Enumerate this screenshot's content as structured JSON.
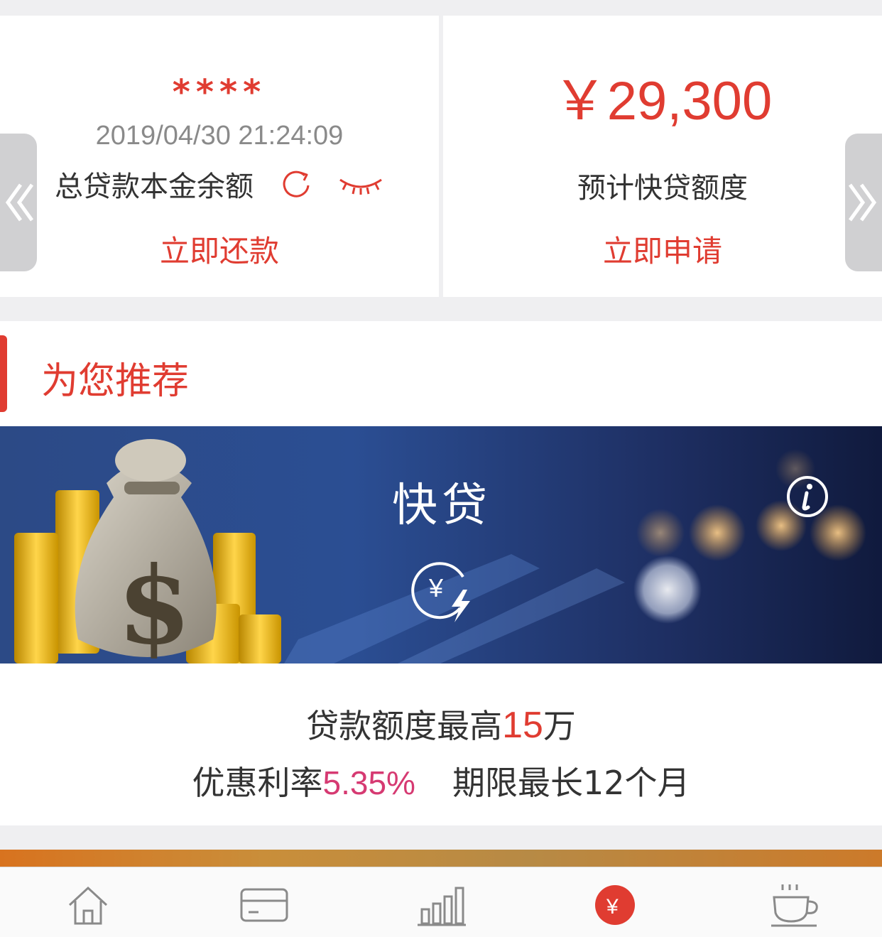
{
  "loan_card": {
    "masked_amount": "****",
    "timestamp": "2019/04/30 21:24:09",
    "label": "总贷款本金余额",
    "action": "立即还款"
  },
  "quota_card": {
    "amount": "￥29,300",
    "label": "预计快贷额度",
    "action": "立即申请"
  },
  "recommend": {
    "title": "为您推荐"
  },
  "banner": {
    "title": "快贷"
  },
  "promo": {
    "line1_prefix": "贷款额度最高",
    "line1_value": "15",
    "line1_suffix": "万",
    "line2_prefix": "优惠利率",
    "line2_rate": "5.35%",
    "line2_term": "期限最长12个月"
  },
  "tabbar": {
    "items": [
      "home-icon",
      "card-icon",
      "chart-icon",
      "loan-icon",
      "coffee-icon"
    ],
    "active_index": 3
  },
  "colors": {
    "accent": "#e03c31",
    "rate_highlight": "#d63a72"
  }
}
